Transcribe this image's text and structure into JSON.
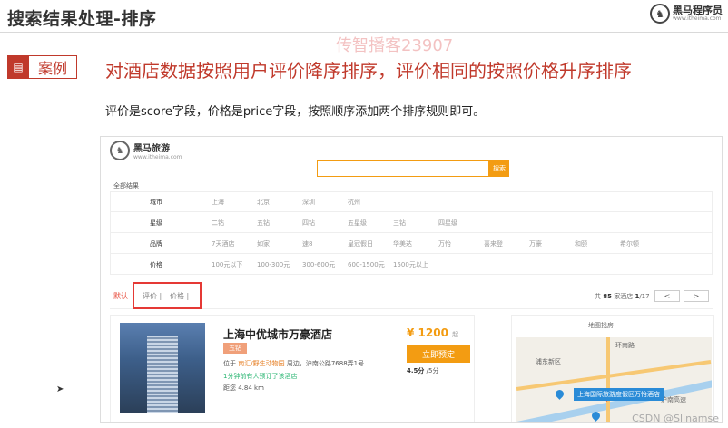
{
  "slide": {
    "title": "搜索结果处理-排序",
    "logo_name": "黑马程序员",
    "logo_url": "www.itheima.com",
    "watermark": "传智播客23907",
    "case_label": "案例",
    "headline": "对酒店数据按照用户评价降序排序，评价相同的按照价格升序排序",
    "description": "评价是score字段，价格是price字段，按照顺序添加两个排序规则即可。",
    "footer": "CSDN @Slinamse"
  },
  "site": {
    "name": "黑马旅游",
    "url": "www.itheima.com",
    "search_button": "搜索",
    "all_results": "全部结果"
  },
  "filters": [
    {
      "label": "城市",
      "items": [
        "上海",
        "北京",
        "深圳",
        "杭州"
      ]
    },
    {
      "label": "星级",
      "items": [
        "二钻",
        "五钻",
        "四钻",
        "五星级",
        "三钻",
        "四星级"
      ]
    },
    {
      "label": "品牌",
      "items": [
        "7天酒店",
        "如家",
        "速8",
        "皇冠假日",
        "华美达",
        "万怡",
        "喜来登",
        "万豪",
        "和颐",
        "希尔顿"
      ]
    },
    {
      "label": "价格",
      "items": [
        "100元以下",
        "100-300元",
        "300-600元",
        "600-1500元",
        "1500元以上"
      ]
    }
  ],
  "sort": {
    "default": "默认",
    "score": "评价 |",
    "price": "价格 |",
    "total_prefix": "共",
    "total_count": "85",
    "total_suffix": "家酒店",
    "page": "1",
    "page_total": "/17",
    "prev": "<",
    "next": ">"
  },
  "hotel": {
    "name": "上海中优城市万豪酒店",
    "brand_badge": "五钻",
    "addr_prefix": "位于",
    "addr_highlight": "南汇/野生动物园",
    "addr_suffix": "周边，沪南公路7688弄1号",
    "booked": "1分钟前有人预订了该酒店",
    "distance": "距您 4.84 km",
    "price": "¥ 1200",
    "price_unit": "起",
    "book_button": "立即预定",
    "rating": "4.5分",
    "rating_max": "/5分"
  },
  "map": {
    "title": "地图找房",
    "hotel_label": "上海国际旅游度假区万怡酒店",
    "place1": "浦东新区",
    "place2": "环南路",
    "place3": "沪南高速"
  }
}
